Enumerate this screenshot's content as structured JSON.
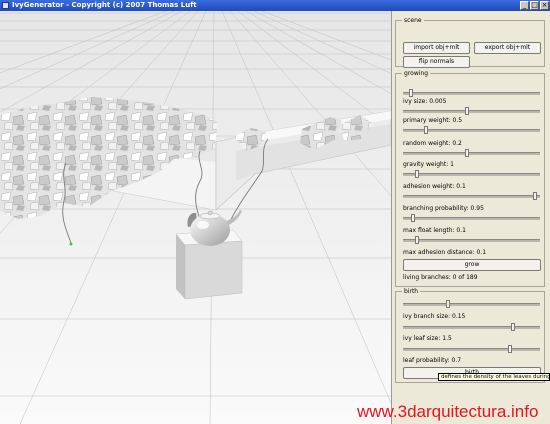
{
  "window": {
    "title": "IvyGenerator - Copyright (c) 2007 Thomas Luft",
    "minimize_glyph": "_",
    "maximize_glyph": "□",
    "close_glyph": "×"
  },
  "scene": {
    "title": "scene",
    "import_label": "import obj+mlt",
    "export_label": "export obj+mlt",
    "flip_label": "flip normals"
  },
  "growing": {
    "title": "growing",
    "sliders": [
      {
        "label": "",
        "value": 0.06
      },
      {
        "label": "ivy size: 0.005",
        "value": 0.47
      },
      {
        "label": "primary weight: 0.5",
        "value": 0.17
      },
      {
        "label": "random weight: 0.2",
        "value": 0.47
      },
      {
        "label": "gravity weight: 1",
        "value": 0.1
      },
      {
        "label": "adhesion weight: 0.1",
        "value": 0.96
      },
      {
        "label": "branching probability: 0.95",
        "value": 0.07
      },
      {
        "label": "max float length: 0.1",
        "value": 0.1
      }
    ],
    "max_adhesion_label": "max adhesion distance: 0.1",
    "grow_label": "grow",
    "living_branches": "living branches: 0 of 189"
  },
  "birth": {
    "title": "birth",
    "sliders": [
      {
        "label": "",
        "value": 0.33
      },
      {
        "label": "ivy branch size: 0.15",
        "value": 0.8
      },
      {
        "label": "ivy leaf size: 1.5",
        "value": 0.78
      }
    ],
    "leaf_probability_label": "leaf probability: 0.7",
    "birth_label": "birth"
  },
  "tooltip": "defines the density of the leaves during ge",
  "watermark": "www.3darquitectura.info",
  "colors": {
    "titlebar": "#2a58c8",
    "panel": "#ece9d8",
    "watermark": "#e8141e"
  }
}
